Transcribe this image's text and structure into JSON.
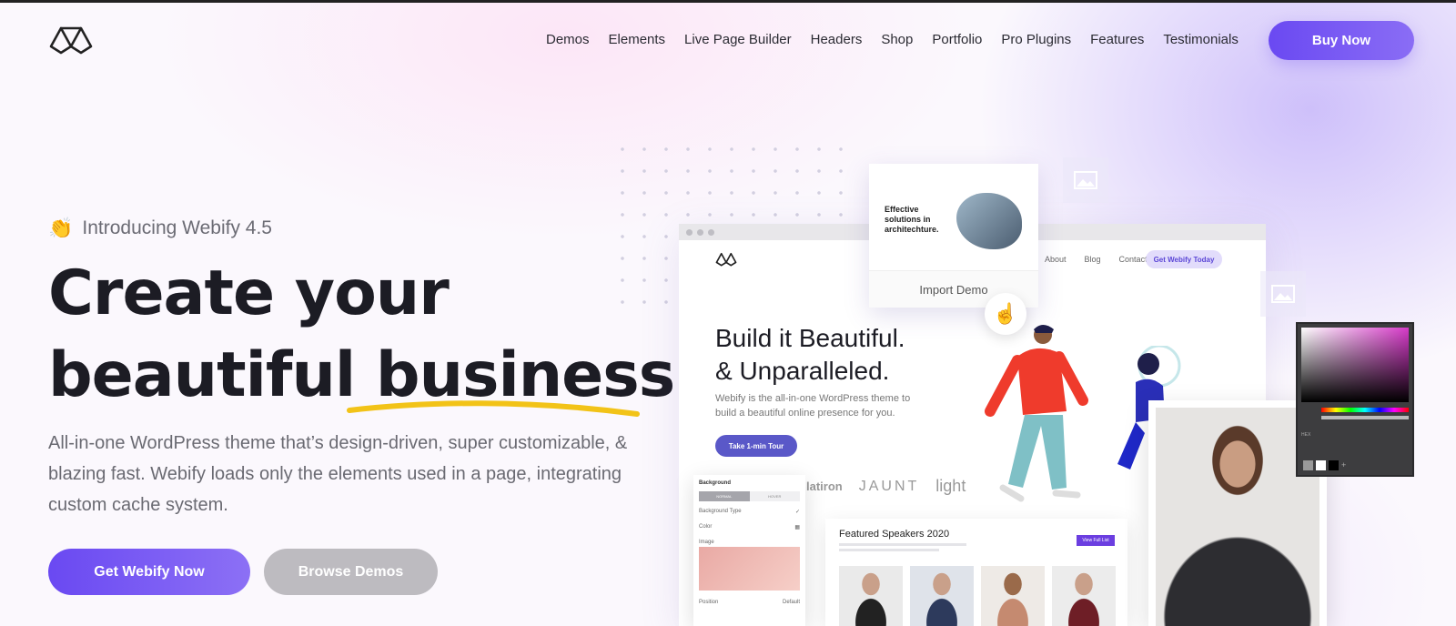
{
  "nav": {
    "items": [
      "Demos",
      "Elements",
      "Live Page Builder",
      "Headers",
      "Shop",
      "Portfolio",
      "Pro Plugins",
      "Features",
      "Testimonials"
    ],
    "buy_label": "Buy Now"
  },
  "hero": {
    "intro_emoji": "👏",
    "intro": "Introducing Webify 4.5",
    "title_line1": "Create your",
    "title_line2a": "beautiful ",
    "title_line2b": "business.",
    "description": "All-in-one WordPress theme that’s design-driven, super customizable, & blazing fast. Webify loads only the elements used in a page, integrating custom cache system.",
    "primary_cta": "Get Webify Now",
    "secondary_cta": "Browse Demos"
  },
  "mockup": {
    "nav": [
      "About",
      "Blog",
      "Contact"
    ],
    "cta": "Get Webify Today",
    "title_line1": "Build it Beautiful.",
    "title_line2": "& Unparalleled.",
    "description": "Webify is the all-in-one WordPress theme to build a beautiful online presence for you.",
    "button": "Take 1-min Tour",
    "brands": [
      "latiron",
      "JAUNT",
      "light"
    ]
  },
  "import_card": {
    "heading": "Effective solutions in architechture.",
    "label": "Import Demo"
  },
  "bg_panel": {
    "title": "Background",
    "tabs": [
      "NORMAL",
      "HOVER"
    ],
    "type_label": "Background Type",
    "color_label": "Color",
    "image_label": "Image",
    "position_label": "Position",
    "position_value": "Default"
  },
  "speakers": {
    "title": "Featured Speakers 2020",
    "button": "View Full List"
  },
  "color_picker": {
    "hex_label": "HEX"
  },
  "colors": {
    "accent": "#6a49f2",
    "underline": "#f2c318"
  }
}
